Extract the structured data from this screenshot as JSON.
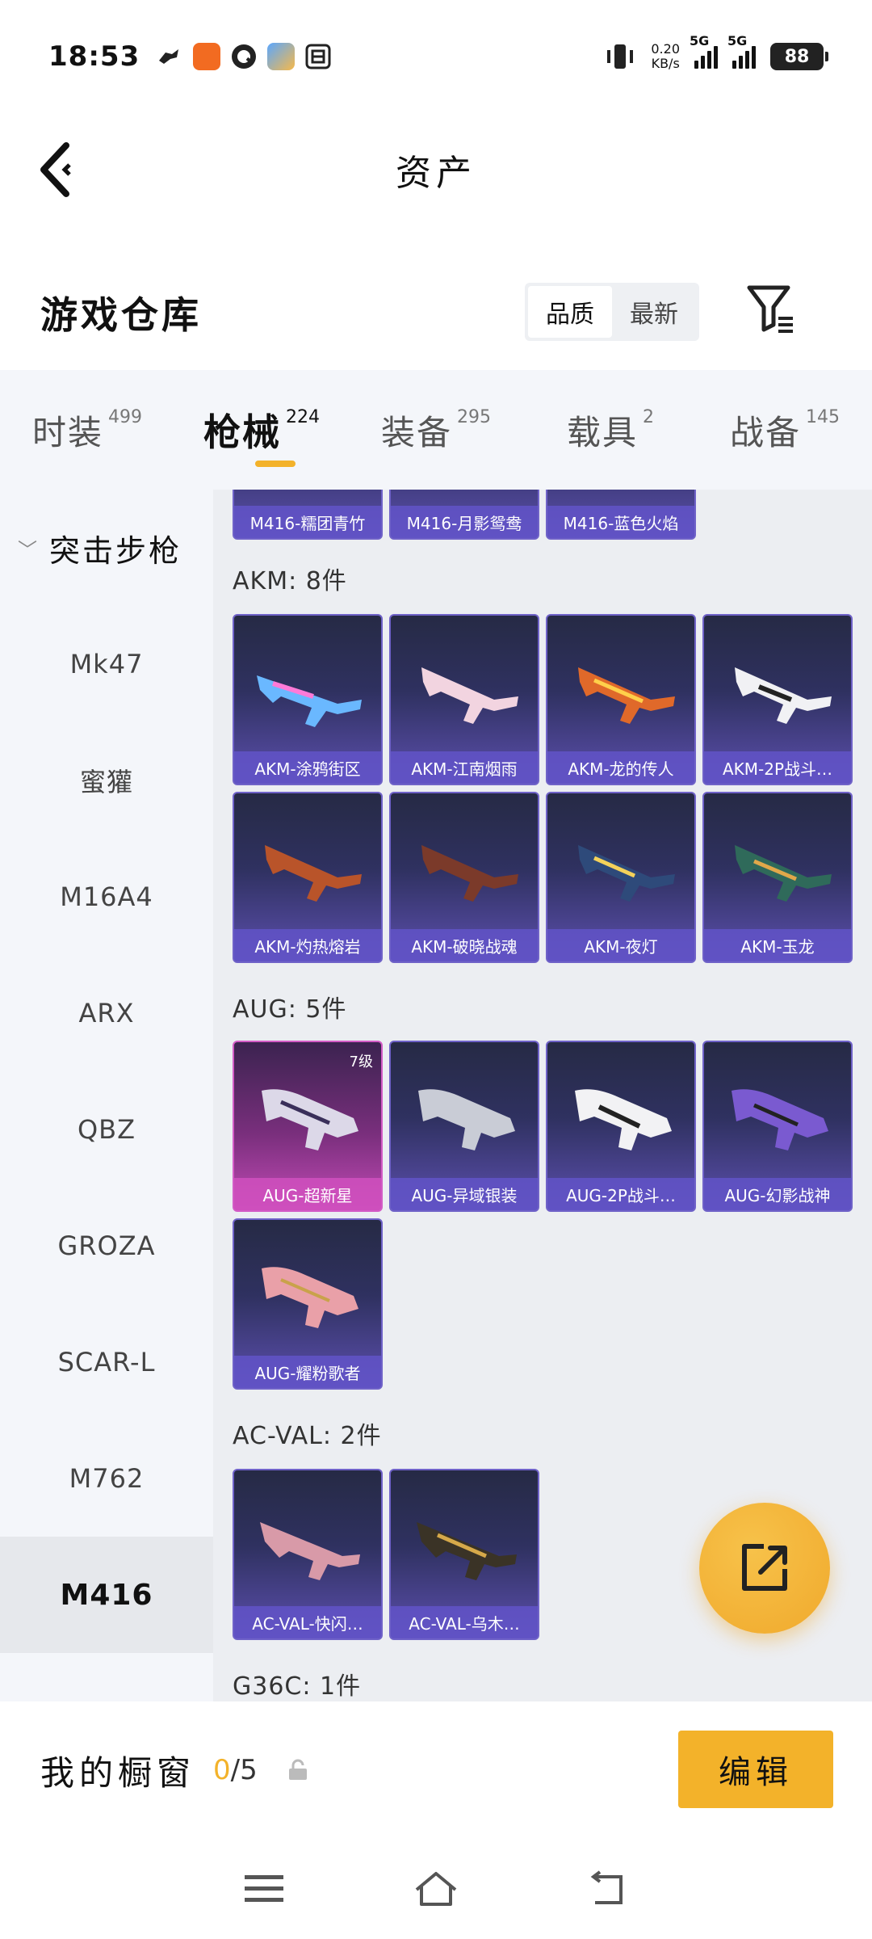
{
  "status_bar": {
    "time": "18:53",
    "net_speed_value": "0.20",
    "net_speed_unit": "KB/s",
    "signal1_label": "5G",
    "signal2_label": "5G",
    "battery": "88"
  },
  "header": {
    "title": "资产"
  },
  "warehouse": {
    "title": "游戏仓库",
    "sort_quality": "品质",
    "sort_newest": "最新"
  },
  "tabs": [
    {
      "label": "时装",
      "count": "499"
    },
    {
      "label": "枪械",
      "count": "224"
    },
    {
      "label": "装备",
      "count": "295"
    },
    {
      "label": "载具",
      "count": "2"
    },
    {
      "label": "战备",
      "count": "145"
    }
  ],
  "sidebar": {
    "group": "突击步枪",
    "items": [
      "Mk47",
      "蜜獾",
      "M16A4",
      "ARX",
      "QBZ",
      "GROZA",
      "SCAR-L",
      "M762",
      "M416"
    ]
  },
  "sections": {
    "top_items": [
      "M416-糯团青竹",
      "M416-月影鸳鸯",
      "M416-蓝色火焰"
    ],
    "akm_title": "AKM: 8件",
    "akm_items": [
      "AKM-涂鸦街区",
      "AKM-江南烟雨",
      "AKM-龙的传人",
      "AKM-2P战斗…",
      "AKM-灼热熔岩",
      "AKM-破晓战魂",
      "AKM-夜灯",
      "AKM-玉龙"
    ],
    "aug_title": "AUG: 5件",
    "aug_items": [
      "AUG-超新星",
      "AUG-异域银装",
      "AUG-2P战斗…",
      "AUG-幻影战神",
      "AUG-耀粉歌者"
    ],
    "aug_level": "7级",
    "acval_title": "AC-VAL: 2件",
    "acval_items": [
      "AC-VAL-快闪…",
      "AC-VAL-乌木…"
    ],
    "g36c_title": "G36C: 1件"
  },
  "bottom": {
    "window_label": "我的橱窗",
    "current": "0",
    "total": "/5",
    "edit": "编辑"
  },
  "colors": {
    "accent": "#f3b22a",
    "card_purple": "#5c4fae",
    "card_pink": "#c24ab5"
  }
}
